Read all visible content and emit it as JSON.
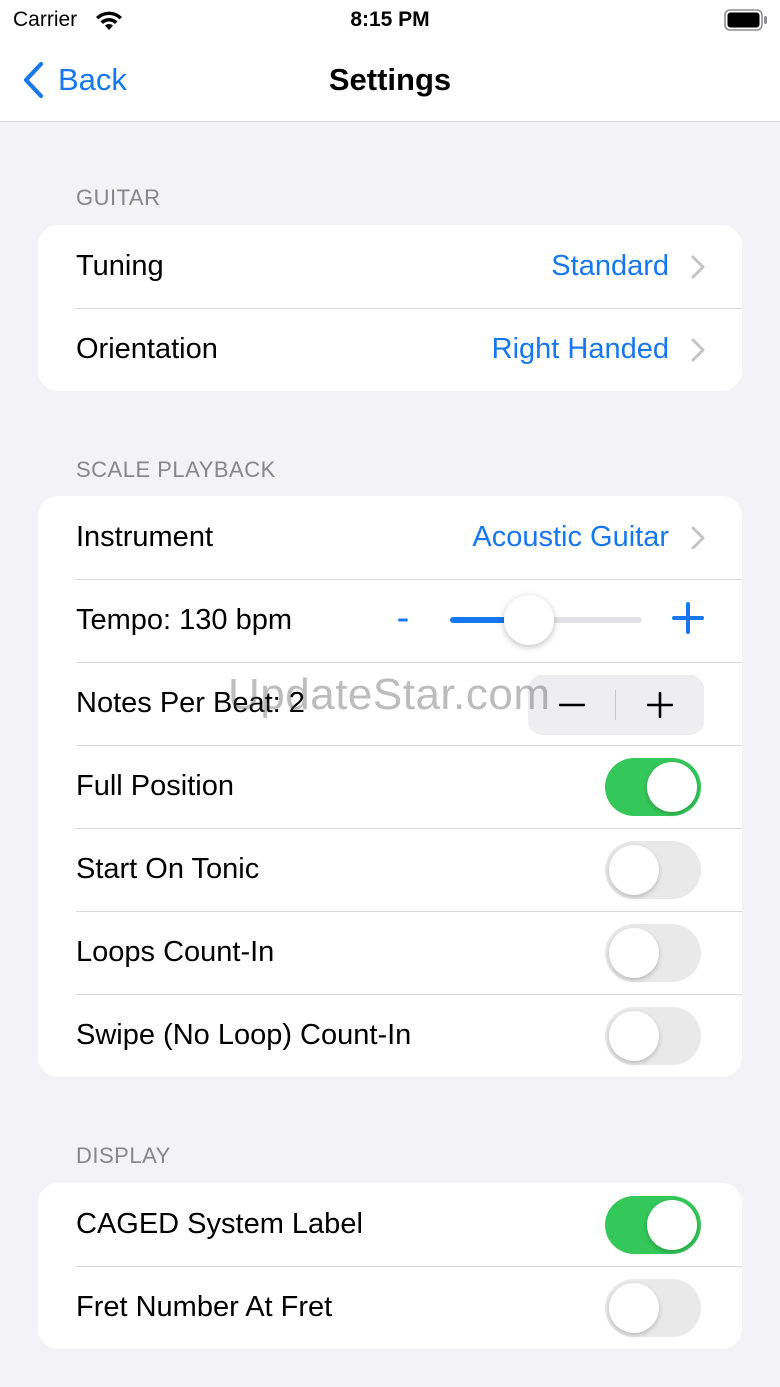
{
  "status_bar": {
    "carrier": "Carrier",
    "time": "8:15 PM",
    "wifi_icon": "wifi-icon",
    "battery_icon": "battery-icon"
  },
  "nav": {
    "back_label": "Back",
    "back_icon": "chevron-left-icon",
    "title": "Settings"
  },
  "colors": {
    "accent": "#1677f0",
    "toggle_on": "#34c759",
    "toggle_off": "#e9e9ea",
    "background": "#f2f2f7"
  },
  "sections": {
    "guitar": {
      "header": "GUITAR",
      "tuning": {
        "label": "Tuning",
        "value": "Standard"
      },
      "orientation": {
        "label": "Orientation",
        "value": "Right Handed"
      }
    },
    "scale_playback": {
      "header": "SCALE PLAYBACK",
      "instrument": {
        "label": "Instrument",
        "value": "Acoustic Guitar"
      },
      "tempo": {
        "label": "Tempo: 130 bpm",
        "minus": "-",
        "slider_fraction": 0.41
      },
      "notes_per_beat": {
        "label": "Notes Per Beat: 2",
        "minus": "−",
        "plus": "+"
      },
      "full_position": {
        "label": "Full Position",
        "on": true
      },
      "start_on_tonic": {
        "label": "Start On Tonic",
        "on": false
      },
      "loops_count_in": {
        "label": "Loops Count-In",
        "on": false
      },
      "swipe_count_in": {
        "label": "Swipe (No Loop) Count-In",
        "on": false
      }
    },
    "display": {
      "header": "DISPLAY",
      "caged_label": {
        "label": "CAGED System Label",
        "on": true
      },
      "fret_number": {
        "label": "Fret Number At Fret",
        "on": false
      }
    }
  },
  "watermark": "UpdateStar.com"
}
